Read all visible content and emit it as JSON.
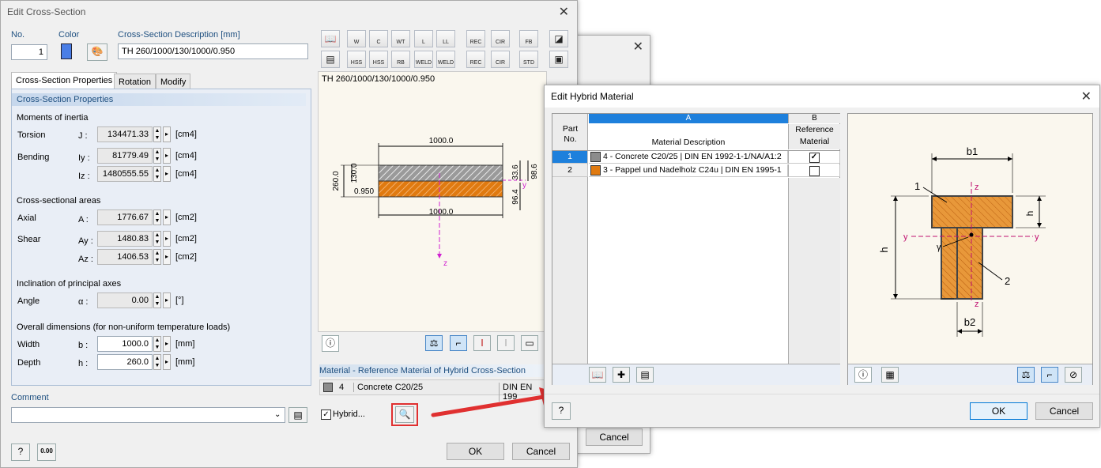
{
  "dlg1": {
    "title": "Edit Cross-Section",
    "no_label": "No.",
    "no_value": "1",
    "color_label": "Color",
    "desc_label": "Cross-Section Description [mm]",
    "desc_value": "TH 260/1000/130/1000/0.950",
    "tabs": [
      "Cross-Section Properties",
      "Rotation",
      "Modify"
    ],
    "props_header": "Cross-Section Properties",
    "moments_title": "Moments of inertia",
    "areas_title": "Cross-sectional areas",
    "incl_title": "Inclination of principal axes",
    "overall_title": "Overall dimensions (for non-uniform temperature loads)",
    "rows": {
      "torsion": {
        "label": "Torsion",
        "sym": "J :",
        "value": "134471.33",
        "unit": "[cm4]"
      },
      "bend_y": {
        "label": "Bending",
        "sym": "Iy :",
        "value": "81779.49",
        "unit": "[cm4]"
      },
      "bend_z": {
        "label": "",
        "sym": "Iz :",
        "value": "1480555.55",
        "unit": "[cm4]"
      },
      "axial": {
        "label": "Axial",
        "sym": "A :",
        "value": "1776.67",
        "unit": "[cm2]"
      },
      "shear_y": {
        "label": "Shear",
        "sym": "Ay :",
        "value": "1480.83",
        "unit": "[cm2]"
      },
      "shear_z": {
        "label": "",
        "sym": "Az :",
        "value": "1406.53",
        "unit": "[cm2]"
      },
      "angle": {
        "label": "Angle",
        "sym": "α :",
        "value": "0.00",
        "unit": "[°]"
      },
      "width": {
        "label": "Width",
        "sym": "b :",
        "value": "1000.0",
        "unit": "[mm]"
      },
      "depth": {
        "label": "Depth",
        "sym": "h :",
        "value": "260.0",
        "unit": "[mm]"
      }
    },
    "comment_label": "Comment",
    "comment_value": "",
    "preview_title": "TH 260/1000/130/1000/0.950",
    "dims": {
      "top": "1000.0",
      "bottom": "1000.0",
      "h_total": "260.0",
      "h_part": "130.0",
      "ratio": "0.950",
      "r1": "98.6",
      "r2": "33.6",
      "r3": "96.4",
      "axis_y": "y",
      "axis_z": "z"
    },
    "material_header": "Material - Reference Material of Hybrid Cross-Section",
    "material_no": "4",
    "material_name": "Concrete C20/25",
    "material_norm": "DIN EN 199",
    "hybrid_label": "Hybrid...",
    "ok": "OK",
    "cancel": "Cancel",
    "toolbar_row1": [
      "W",
      "C",
      "WT",
      "L",
      "LL",
      "REC",
      "CIR",
      "FB"
    ],
    "toolbar_row2": [
      "HSS",
      "HSS",
      "RB",
      "WELD",
      "WELD",
      "REC",
      "CIR",
      "STD"
    ],
    "calc_icon_text": "0.00"
  },
  "dlg_back": {
    "cancel": "Cancel"
  },
  "dlg2": {
    "title": "Edit Hybrid Material",
    "col_a": "A",
    "col_b": "B",
    "part_no_1": "Part",
    "part_no_2": "No.",
    "mat_desc": "Material Description",
    "ref_1": "Reference",
    "ref_2": "Material",
    "rows": [
      {
        "no": "1",
        "desc": "4 - Concrete C20/25 | DIN EN 1992-1-1/NA/A1:2",
        "color": "#8c8c8c",
        "ref": true
      },
      {
        "no": "2",
        "desc": "3 - Pappel und Nadelholz C24u | DIN EN 1995-1",
        "color": "#e07a10",
        "ref": false
      }
    ],
    "diagram": {
      "b1": "b1",
      "b2": "b2",
      "h": "h",
      "hf": "h",
      "lbl1": "1",
      "lbl2": "2",
      "y": "y",
      "z": "z"
    },
    "ok": "OK",
    "cancel": "Cancel"
  },
  "colors": {
    "accent": "#0078d7",
    "concrete": "#8c8c8c",
    "wood": "#e07a10",
    "highlight": "#e03030"
  }
}
